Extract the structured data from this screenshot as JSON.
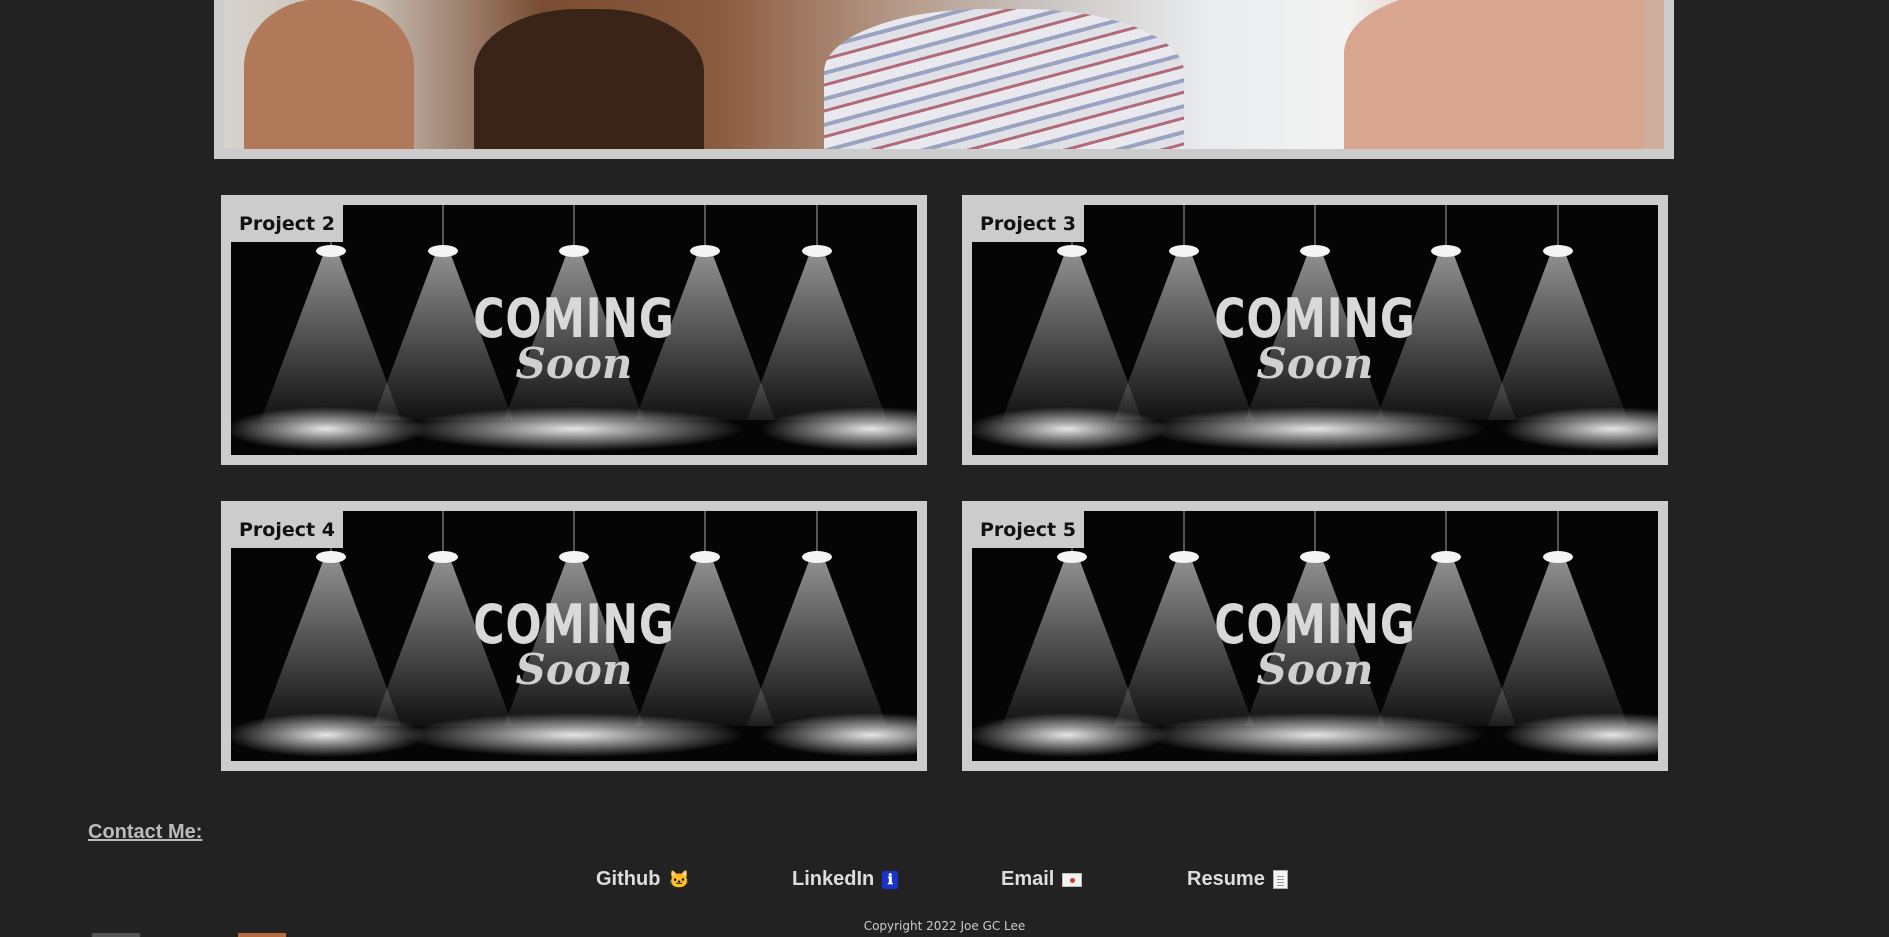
{
  "hero": {
    "image": "team-meeting-photo"
  },
  "projects": [
    {
      "label": "Project 2",
      "image_text": {
        "line1": "COMING",
        "line2": "Soon"
      }
    },
    {
      "label": "Project 3",
      "image_text": {
        "line1": "COMING",
        "line2": "Soon"
      }
    },
    {
      "label": "Project 4",
      "image_text": {
        "line1": "COMING",
        "line2": "Soon"
      }
    },
    {
      "label": "Project 5",
      "image_text": {
        "line1": "COMING",
        "line2": "Soon"
      }
    }
  ],
  "contact": {
    "heading": "Contact Me:",
    "links": [
      {
        "label": "Github",
        "icon": "cat-emoji-icon",
        "glyph": "🐱"
      },
      {
        "label": "LinkedIn",
        "icon": "info-icon",
        "glyph": "ℹ"
      },
      {
        "label": "Email",
        "icon": "envelope-icon",
        "glyph": ""
      },
      {
        "label": "Resume",
        "icon": "document-icon",
        "glyph": ""
      }
    ]
  },
  "footer": {
    "copyright": "Copyright 2022 Joe GC Lee"
  },
  "colors": {
    "page_background": "#222222",
    "card_frame": "#cccccc",
    "link_text": "#dddddd",
    "heading_text": "#bbbbbb"
  }
}
